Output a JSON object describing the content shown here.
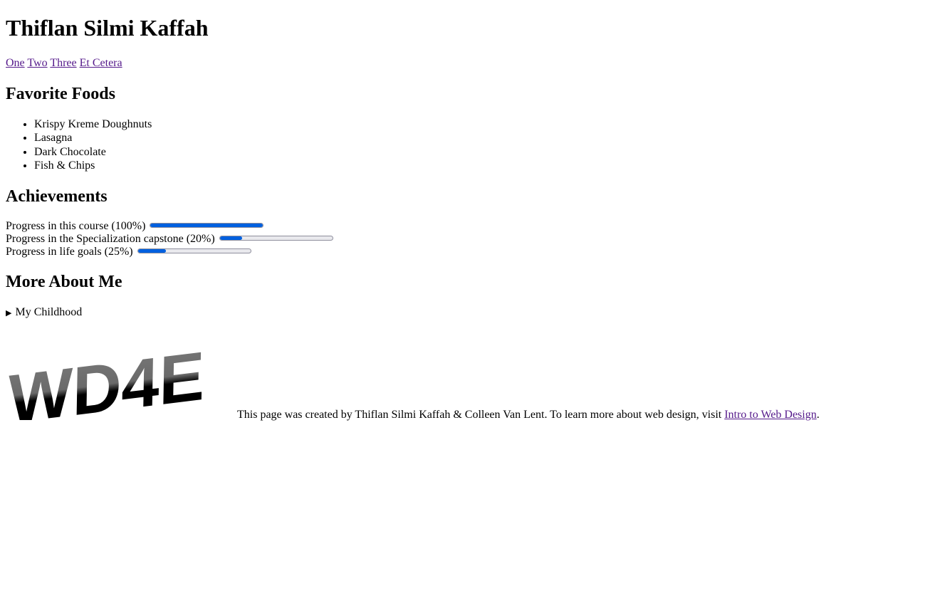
{
  "header": {
    "title": "Thiflan Silmi Kaffah"
  },
  "nav": {
    "links": [
      "One",
      "Two",
      "Three",
      "Et Cetera"
    ]
  },
  "foods": {
    "heading": "Favorite Foods",
    "items": [
      "Krispy Kreme Doughnuts",
      "Lasagna",
      "Dark Chocolate",
      "Fish & Chips"
    ]
  },
  "achievements": {
    "heading": "Achievements",
    "items": [
      {
        "label": "Progress in this course (100%)",
        "value": 100
      },
      {
        "label": "Progress in the Specialization capstone (20%)",
        "value": 20
      },
      {
        "label": "Progress in life goals (25%)",
        "value": 25
      }
    ]
  },
  "more": {
    "heading": "More About Me",
    "summary": "My Childhood"
  },
  "footer": {
    "logo_text": "WD4E",
    "text_before": "This page was created by Thiflan Silmi Kaffah & Colleen Van Lent. To learn more about web design, visit ",
    "link_text": "Intro to Web Design",
    "text_after": "."
  },
  "colors": {
    "link": "#551a8b",
    "progress_fill": "#0060df",
    "progress_track": "#e9e9ed"
  }
}
